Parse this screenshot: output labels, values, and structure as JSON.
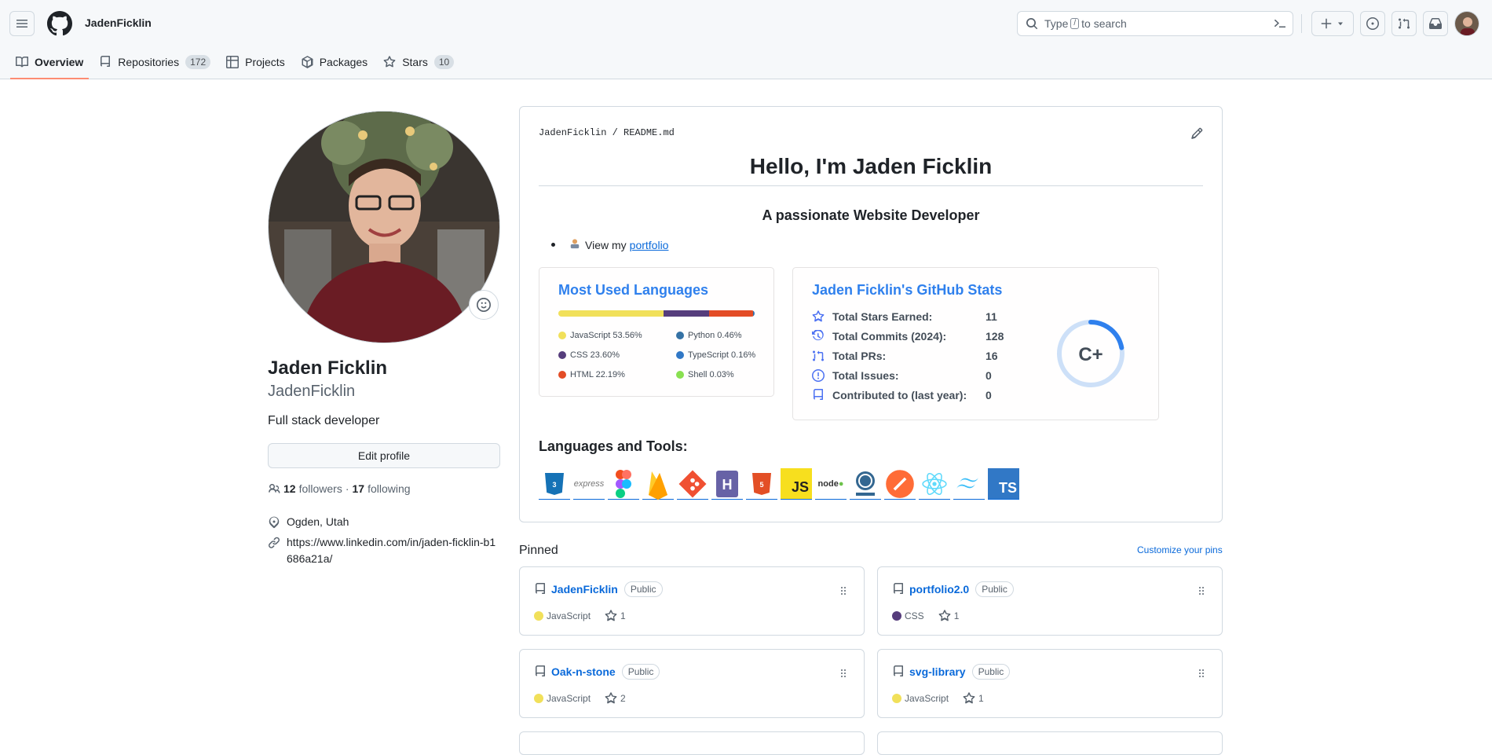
{
  "header": {
    "username": "JadenFicklin",
    "search_text_pre": "Type",
    "search_key": "/",
    "search_text_post": "to search"
  },
  "tabs": [
    {
      "label": "Overview",
      "count": ""
    },
    {
      "label": "Repositories",
      "count": "172"
    },
    {
      "label": "Projects",
      "count": ""
    },
    {
      "label": "Packages",
      "count": ""
    },
    {
      "label": "Stars",
      "count": "10"
    }
  ],
  "profile": {
    "name": "Jaden Ficklin",
    "login": "JadenFicklin",
    "bio": "Full stack developer",
    "edit_label": "Edit profile",
    "followers_count": "12",
    "followers_label": "followers",
    "sep": "·",
    "following_count": "17",
    "following_label": "following",
    "location": "Ogden, Utah",
    "link": "https://www.linkedin.com/in/jaden-ficklin-b1686a21a/"
  },
  "readme": {
    "owner": "JadenFicklin",
    "slash": "/",
    "file": "README.md",
    "title": "Hello, I'm Jaden Ficklin",
    "subtitle": "A passionate Website Developer",
    "portfolio_prefix": "View my",
    "portfolio_link": "portfolio",
    "languages_title": "Most Used Languages",
    "languages": [
      {
        "label": "JavaScript 53.56%",
        "color": "#f1e05a",
        "pct": 53.56
      },
      {
        "label": "Python 0.46%",
        "color": "#3572A5",
        "pct": 0.46
      },
      {
        "label": "CSS 23.60%",
        "color": "#563d7c",
        "pct": 23.6
      },
      {
        "label": "TypeScript 0.16%",
        "color": "#3178c6",
        "pct": 0.16
      },
      {
        "label": "HTML 22.19%",
        "color": "#e34c26",
        "pct": 22.19
      },
      {
        "label": "Shell 0.03%",
        "color": "#89e051",
        "pct": 0.03
      }
    ],
    "stats_title": "Jaden Ficklin's GitHub Stats",
    "stats": [
      {
        "label": "Total Stars Earned:",
        "value": "11"
      },
      {
        "label": "Total Commits (2024):",
        "value": "128"
      },
      {
        "label": "Total PRs:",
        "value": "16"
      },
      {
        "label": "Total Issues:",
        "value": "0"
      },
      {
        "label": "Contributed to (last year):",
        "value": "0"
      }
    ],
    "grade": "C+",
    "grade_progress": 0.22,
    "tools_title": "Languages and Tools:",
    "tools": [
      "CSS",
      "express",
      "figma",
      "firebase",
      "git",
      "heroku",
      "HTML",
      "JS",
      "node",
      "PostgreSQL",
      "postman",
      "React",
      "tailwind",
      "TS"
    ]
  },
  "pinned": {
    "heading": "Pinned",
    "customize": "Customize your pins",
    "public_label": "Public",
    "repos": [
      {
        "name": "JadenFicklin",
        "lang": "JavaScript",
        "color": "#f1e05a",
        "stars": "1"
      },
      {
        "name": "portfolio2.0",
        "lang": "CSS",
        "color": "#563d7c",
        "stars": "1"
      },
      {
        "name": "Oak-n-stone",
        "lang": "JavaScript",
        "color": "#f1e05a",
        "stars": "2"
      },
      {
        "name": "svg-library",
        "lang": "JavaScript",
        "color": "#f1e05a",
        "stars": "1"
      }
    ]
  }
}
